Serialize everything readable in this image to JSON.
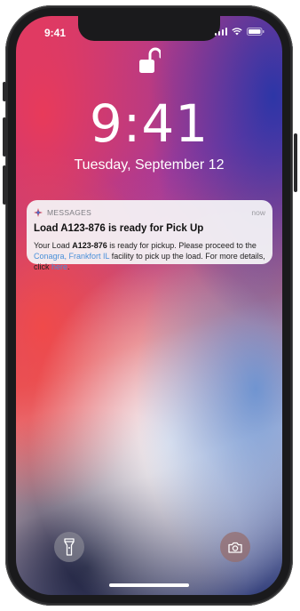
{
  "status_bar": {
    "time": "9:41",
    "icons": [
      "signal-icon",
      "wifi-icon",
      "battery-icon"
    ]
  },
  "lock_screen": {
    "lock_icon": "unlocked-padlock-icon",
    "clock": "9:41",
    "date": "Tuesday, September 12"
  },
  "notification": {
    "app_icon": "messages-app-icon",
    "app_name": "MESSAGES",
    "time": "now",
    "title": "Load A123-876 is ready for Pick Up",
    "body": {
      "part1": "Your Load ",
      "load_id": "A123-876",
      "part2": " is ready for pickup. Please proceed to the ",
      "facility_link": "Conagra, Frankfort IL",
      "part3": " facility to pick up the load. For more details, click ",
      "here_link": "here",
      "part4": "."
    }
  },
  "quick_actions": {
    "flashlight_icon": "flashlight-icon",
    "camera_icon": "camera-icon"
  },
  "colors": {
    "notification_bg": "#F5F5F7",
    "link": "#4A90D9",
    "text": "#222222",
    "secondary_text": "#7C7C82"
  }
}
